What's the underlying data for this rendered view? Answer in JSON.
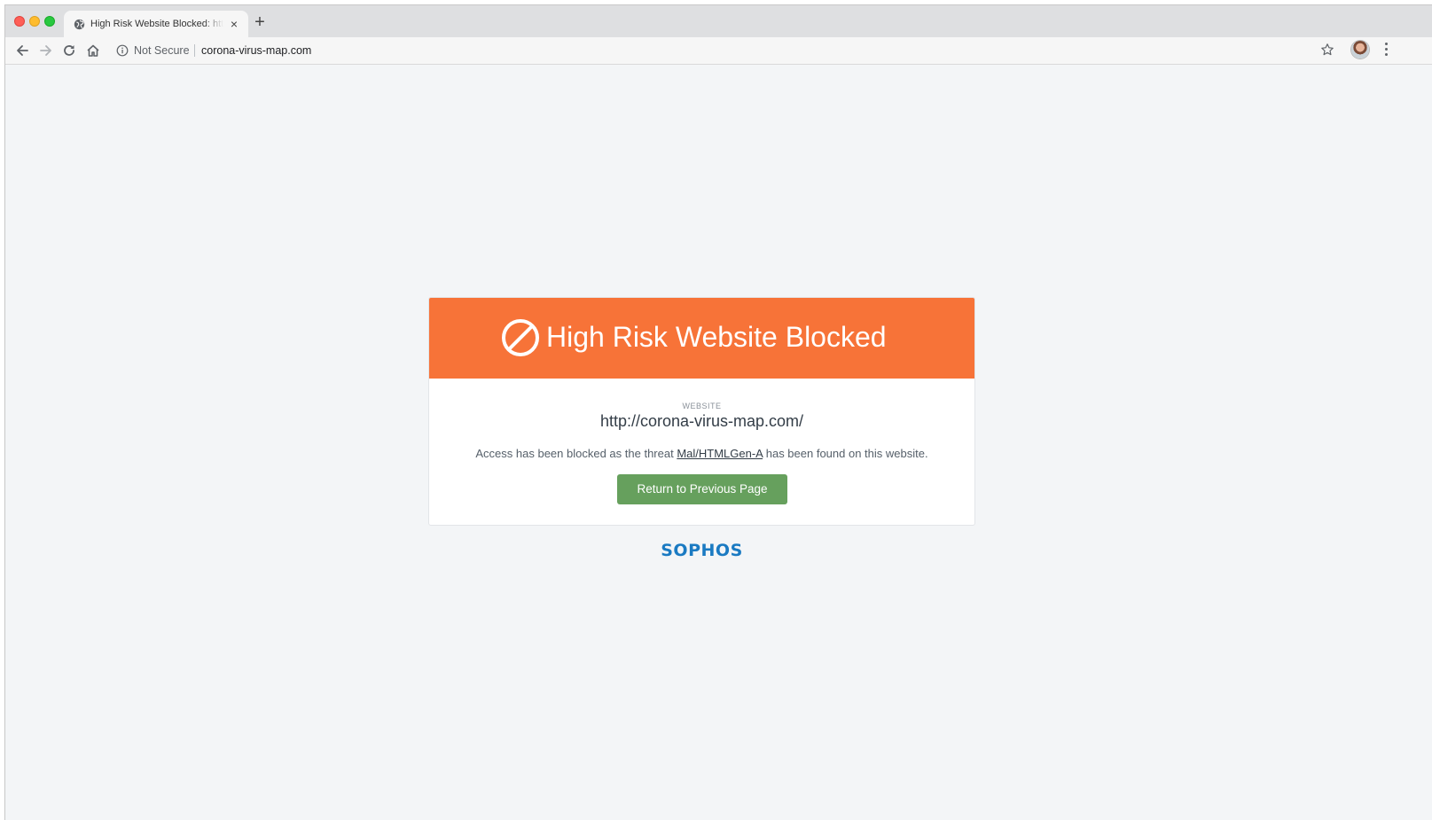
{
  "browser": {
    "tab": {
      "title": "High Risk Website Blocked: htt",
      "close_glyph": "×"
    },
    "new_tab_glyph": "+",
    "omnibox": {
      "security_label": "Not Secure",
      "url": "corona-virus-map.com"
    }
  },
  "page": {
    "title": "High Risk Website Blocked",
    "website_label": "WEBSITE",
    "website_url": "http://corona-virus-map.com/",
    "message_before": "Access has been blocked as the threat ",
    "threat_name": "Mal/HTMLGen-A",
    "message_after": " has been found on this website.",
    "return_button": "Return to Previous Page",
    "brand": "SOPHOS"
  },
  "colors": {
    "header_orange": "#f77338",
    "button_green": "#66a05d",
    "brand_blue": "#1a7ac2",
    "page_bg": "#f3f5f7"
  },
  "icons": [
    "globe-icon",
    "close-icon",
    "plus-icon",
    "back-arrow-icon",
    "forward-arrow-icon",
    "reload-icon",
    "home-icon",
    "info-icon",
    "star-icon",
    "avatar",
    "kebab-menu-icon",
    "block-icon"
  ]
}
